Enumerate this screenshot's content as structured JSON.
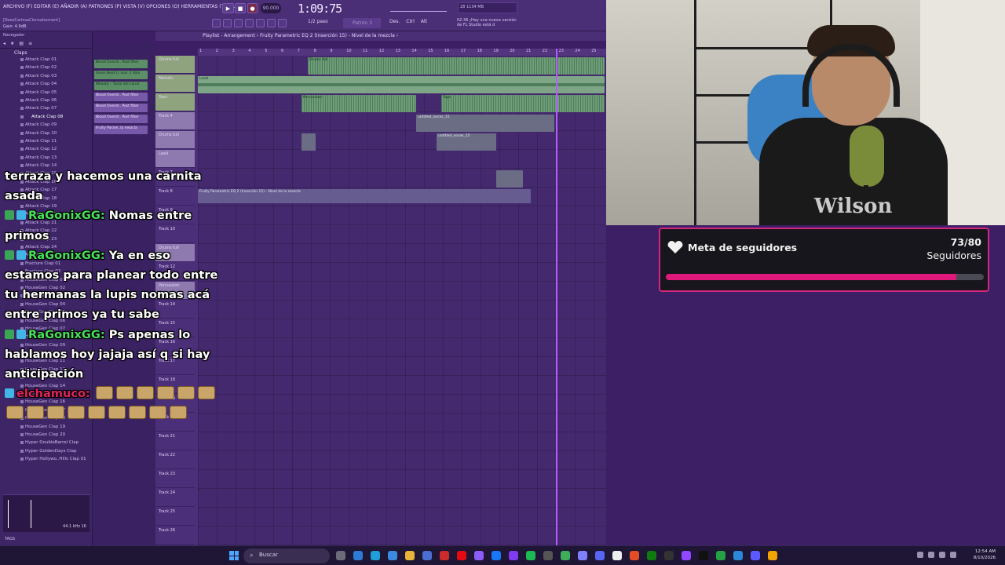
{
  "menubar": {
    "menu_text": "ARCHIVO (F)  EDITAR (E)  AÑADIR (A)  PATRONES (P)  VISTA (V)  OPCIONES (O)  HERRAMIENTAS (T)  AYUDA",
    "hint": "[NoseCarlosaClonsalocment]",
    "gain": "Gain: 4.9dB",
    "tempo": "90.000",
    "time": "1:09:75",
    "cpu_label": "28        1134 MB",
    "news": "02:36 ¡Hay una nueva versión de FL Studio está d",
    "paso": "1/2 paso",
    "pattern": "Patrón 3",
    "controls": "Des. Ctrl Alt"
  },
  "browser": {
    "title": "Navegador",
    "folder": "Claps",
    "items": [
      "Attack Clap 01",
      "Attack Clap 02",
      "Attack Clap 03",
      "Attack Clap 04",
      "Attack Clap 05",
      "Attack Clap 06",
      "Attack Clap 07",
      "Attack Clap 08",
      "Attack Clap 09",
      "Attack Clap 10",
      "Attack Clap 11",
      "Attack Clap 12",
      "Attack Clap 13",
      "Attack Clap 14",
      "Attack Clap 15",
      "Attack Clap 16",
      "Attack Clap 17",
      "Attack Clap 18",
      "Attack Clap 19",
      "Attack Clap 20",
      "Attack Clap 21",
      "Attack Clap 22",
      "Attack Clap 23",
      "Attack Clap 24",
      "Attack Clap 25",
      "Fracture Clap 01",
      "Fracture Clap 02",
      "HouseGen Clap 01",
      "HouseGen Clap 02",
      "HouseGen Clap 03",
      "HouseGen Clap 04",
      "HouseGen Clap 05",
      "HouseGen Clap 06",
      "HouseGen Clap 07",
      "HouseGen Clap 08",
      "HouseGen Clap 09",
      "HouseGen Clap 10",
      "HouseGen Clap 11",
      "HouseGen Clap 12",
      "HouseGen Clap 13",
      "HouseGen Clap 14",
      "HouseGen Clap 15",
      "HouseGen Clap 16",
      "HouseGen Clap 17",
      "HouseGen Clap 18",
      "HouseGen Clap 19",
      "HouseGen Clap 20",
      "Hyper DoubleBarrel Clap",
      "Hyper GoldenDays Clap",
      "Hyper Hollywo..Hills Clap 01"
    ],
    "preview_rate": "44.1 kHz 16",
    "tags": "TAGS"
  },
  "picker": {
    "items": [
      {
        "label": "Blood Overdr.. Post filter",
        "color": "green"
      },
      {
        "label": "Gross Beat (l..ssor 2 Volu",
        "color": "green"
      },
      {
        "label": "Melodic - Tonal del canal",
        "color": "green"
      },
      {
        "label": "Blood Overdr.. Post filter",
        "color": "purple"
      },
      {
        "label": "Blood Overdr.. Post filter",
        "color": "purple"
      },
      {
        "label": "Blood Overdr.. Post filter",
        "color": "purple"
      },
      {
        "label": "Fruity Param..la mezcla",
        "color": "purple"
      }
    ]
  },
  "playlist": {
    "header": "Playlist - Arrangement › Fruity Parametric EQ 2 (Inserción 15) - Nivel de la mezcla ›",
    "ruler": [
      "1",
      "2",
      "3",
      "4",
      "5",
      "6",
      "7",
      "8",
      "9",
      "10",
      "11",
      "12",
      "13",
      "14",
      "15",
      "16",
      "17",
      "18",
      "19",
      "20",
      "21",
      "22",
      "23",
      "24",
      "25"
    ],
    "tracks": [
      "Drums full",
      "Melodic",
      "Tops",
      "Track 4",
      "Drums full",
      "Lead",
      "Track 7",
      "Track 8",
      "Track 9",
      "Track 10",
      "Drums full",
      "Track 12",
      "Percussion",
      "Track 14",
      "Track 15",
      "Track 16",
      "Track 17",
      "Track 18",
      "Track 19",
      "Track 20",
      "Track 21",
      "Track 22",
      "Track 23",
      "Track 24",
      "Track 25",
      "Track 26"
    ],
    "clip_labels": {
      "drums": "Drums full",
      "lead": "Lead",
      "perc": "Percussion",
      "tops": "Tops",
      "untitled": "untitled_voces_15",
      "automation": "Fruity Parametric EQ 2 (Inserción 15) - Nivel de la mezcla"
    }
  },
  "chat": [
    {
      "badges": [],
      "user": "",
      "text": "terraza y hacemos una carnita asada"
    },
    {
      "badges": [
        "check",
        "chat"
      ],
      "user": "RaGonixGG:",
      "text": "Nomas entre primos"
    },
    {
      "badges": [
        "check",
        "chat"
      ],
      "user": "RaGonixGG:",
      "text": "Ya en eso estamos para planear todo entre tu hermanas la lupis nomas acá entre primos ya tu sabe"
    },
    {
      "badges": [
        "check",
        "chat"
      ],
      "user": "RaGonixGG:",
      "text": "Ps apenas lo hablamos hoy jajaja así q si hay anticipación"
    },
    {
      "badges": [
        "chat"
      ],
      "user": "elchamuco:",
      "text": "",
      "emotes": 15
    }
  ],
  "webcam": {
    "shirt": "Wilson"
  },
  "goal": {
    "title": "Meta de seguidores",
    "count": "73/80",
    "label": "Seguidores",
    "current": 73,
    "target": 80,
    "accent": "#e0187c"
  },
  "taskbar": {
    "search": "Buscar",
    "time": "12:54 AM",
    "date": "8/10/2026"
  }
}
